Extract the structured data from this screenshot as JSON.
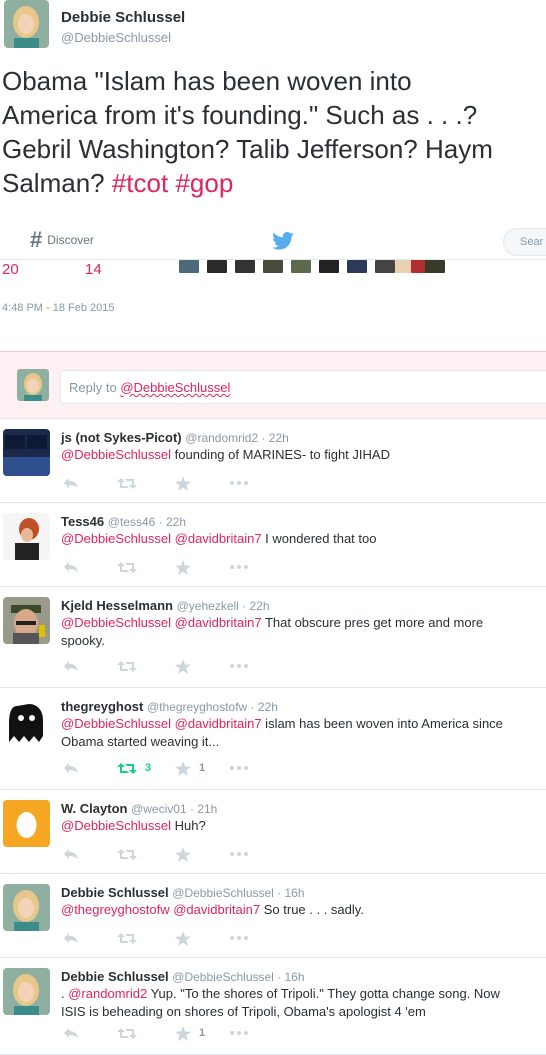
{
  "tweet": {
    "name": "Debbie Schlussel",
    "handle": "@DebbieSchlussel",
    "line1": "Obama \"Islam has been woven into",
    "line2": "America from it's founding.\" Such as . . .?",
    "line3": "Gebril Washington? Talib Jefferson? Haym",
    "line4": "Salman? ",
    "tag1": "#tcot",
    "tag2": "#gop",
    "retweets": "20",
    "favorites": "14",
    "timestamp": "4:48 PM - 18 Feb 2015"
  },
  "nav": {
    "discover": "Discover",
    "search_placeholder": "Sear"
  },
  "reply_box": {
    "prefix": "Reply to ",
    "mention": "@DebbieSchlussel"
  },
  "replies": [
    {
      "name": "js (not Sykes-Picot)",
      "handle": "@randomrid2 · 22h",
      "mentions": "@DebbieSchlussel",
      "text": " founding of MARINES- to fight JIHAD",
      "retweets": "",
      "favorites": ""
    },
    {
      "name": "Tess46",
      "handle": "@tess46 · 22h",
      "mentions": "@DebbieSchlussel @davidbritain7",
      "text": " I wondered that too",
      "retweets": "",
      "favorites": ""
    },
    {
      "name": "Kjeld Hesselmann",
      "handle": "@yehezkell · 22h",
      "mentions": "@DebbieSchlussel @davidbritain7",
      "text": " That obscure pres get more and more",
      "text2": "spooky.",
      "retweets": "",
      "favorites": ""
    },
    {
      "name": "thegreyghost",
      "handle": "@thegreyghostofw · 22h",
      "mentions": "@DebbieSchlussel @davidbritain7",
      "text": " islam has been woven into America since",
      "text2": "Obama started weaving it...",
      "retweets": "3",
      "favorites": "1"
    },
    {
      "name": "W. Clayton",
      "handle": "@weciv01 · 21h",
      "mentions": "@DebbieSchlussel",
      "text": " Huh?",
      "retweets": "",
      "favorites": ""
    },
    {
      "name": "Debbie Schlussel",
      "handle": "@DebbieSchlussel · 16h",
      "mentions": "@thegreyghostofw @davidbritain7",
      "text": " So true . . . sadly.",
      "retweets": "",
      "favorites": ""
    },
    {
      "name": "Debbie Schlussel",
      "handle": "@DebbieSchlussel · 16h",
      "prefix": ". ",
      "mentions": "@randomrid2",
      "text": " Yup. \"To the shores of Tripoli.\" They gotta change song. Now",
      "text2": "ISIS is beheading on shores of Tripoli, Obama's apologist 4 'em",
      "retweets": "",
      "favorites": "1"
    }
  ],
  "colors": {
    "accent": "#e0245e",
    "retweet_active": "#19cf86",
    "muted": "#8899a6",
    "twitter_blue": "#55acee"
  }
}
